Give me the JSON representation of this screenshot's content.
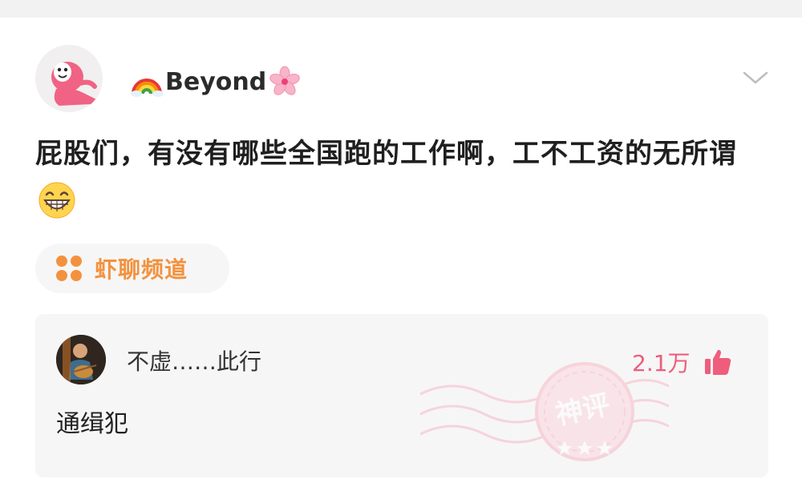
{
  "post": {
    "username": "Beyond",
    "username_prefix_icon": "rainbow-emoji",
    "username_suffix_icon": "cherry-blossom-emoji",
    "text": "屁股们，有没有哪些全国跑的工作啊，工不工资的无所谓",
    "text_suffix_icon": "grinning-face-emoji",
    "more_icon": "chevron-down-icon"
  },
  "channel": {
    "label": "虾聊频道",
    "icon": "four-dots-icon"
  },
  "comment": {
    "author": "不虚……此行",
    "text": "通缉犯",
    "likes": "2.1万",
    "like_icon": "thumbs-up-icon",
    "stamp_text": "神评",
    "stamp_icon": "hot-comment-stamp"
  },
  "colors": {
    "accent_orange": "#f3923e",
    "accent_pink": "#ef5d7c",
    "background": "#ffffff",
    "page_background": "#f2f2f2",
    "comment_background": "#f6f6f6"
  }
}
